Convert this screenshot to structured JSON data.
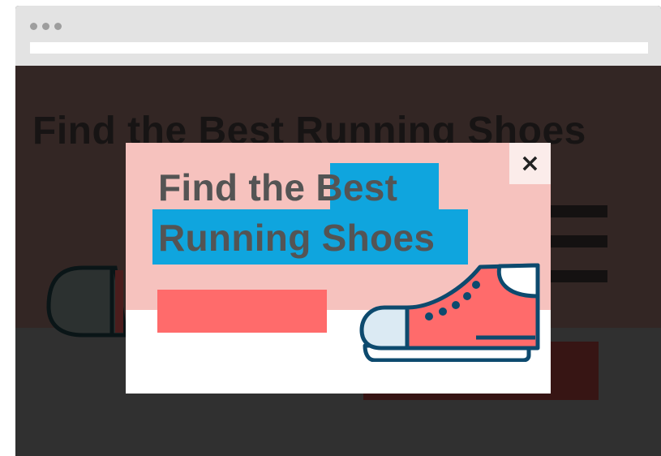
{
  "browser": {
    "window_dots": [
      "dot",
      "dot",
      "dot"
    ],
    "address_value": ""
  },
  "background_page": {
    "title": "Find the Best Running Shoes"
  },
  "modal": {
    "title_part1": "Find the",
    "title_highlight_line1": "Best",
    "title_highlight_line2": "Running Shoes",
    "close_label": "×",
    "close_icon": "close-icon",
    "cta_label": "",
    "illustration": "sneaker-icon"
  },
  "colors": {
    "overlay_dark": "#303030",
    "modal_pink": "#f6c2be",
    "highlight_blue": "#0fa5de",
    "cta_coral": "#ff6b6b",
    "shoe_outline": "#0d4a6e",
    "shoe_body": "#ff6b6b",
    "shoe_toe": "#dbeaf3"
  }
}
